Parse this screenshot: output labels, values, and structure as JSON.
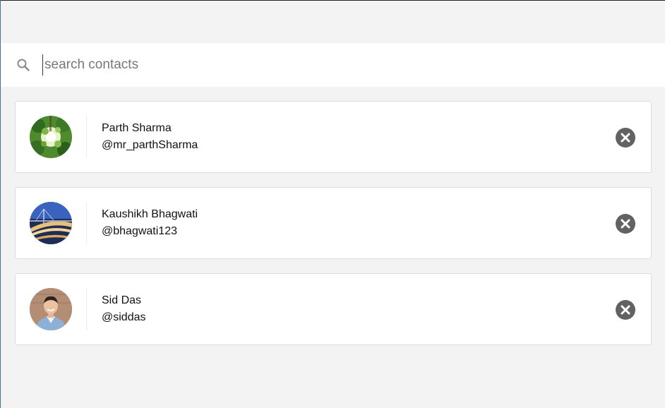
{
  "search": {
    "placeholder": "search contacts",
    "value": "",
    "icon": "search-icon"
  },
  "contacts": [
    {
      "name": "Parth Sharma",
      "handle": "@mr_parthSharma",
      "avatar": "trees-photo",
      "remove_icon": "close-icon"
    },
    {
      "name": "Kaushikh Bhagwati",
      "handle": "@bhagwati123",
      "avatar": "bridge-photo",
      "remove_icon": "close-icon"
    },
    {
      "name": "Sid Das",
      "handle": "@siddas",
      "avatar": "person-photo",
      "remove_icon": "close-icon"
    }
  ],
  "colors": {
    "background": "#f3f3f3",
    "card": "#ffffff",
    "remove_button": "#626262"
  }
}
